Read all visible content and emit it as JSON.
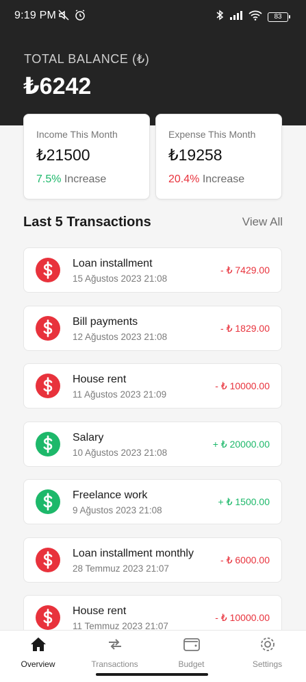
{
  "status_bar": {
    "time": "9:19 PM",
    "battery": "83",
    "icons": [
      "mute-icon",
      "alarm-icon",
      "bluetooth-icon",
      "signal-icon",
      "wifi-icon",
      "battery-icon"
    ]
  },
  "balance": {
    "label": "TOTAL BALANCE (₺)",
    "value": "₺6242"
  },
  "income_card": {
    "title": "Income This Month",
    "amount": "₺21500",
    "percent": "7.5%",
    "trend": "Increase"
  },
  "expense_card": {
    "title": "Expense This Month",
    "amount": "₺19258",
    "percent": "20.4%",
    "trend": "Increase"
  },
  "transactions_section": {
    "title": "Last 5 Transactions",
    "view_all": "View All"
  },
  "transactions": [
    {
      "name": "Loan installment",
      "date": "15 Ağustos 2023 21:08",
      "amount": "- ₺ 7429.00",
      "type": "expense"
    },
    {
      "name": "Bill payments",
      "date": "12 Ağustos 2023 21:08",
      "amount": "- ₺ 1829.00",
      "type": "expense"
    },
    {
      "name": "House rent",
      "date": "11 Ağustos 2023 21:09",
      "amount": "- ₺ 10000.00",
      "type": "expense"
    },
    {
      "name": "Salary",
      "date": "10 Ağustos 2023 21:08",
      "amount": "+ ₺ 20000.00",
      "type": "income"
    },
    {
      "name": "Freelance work",
      "date": "9 Ağustos 2023 21:08",
      "amount": "+ ₺ 1500.00",
      "type": "income"
    },
    {
      "name": "Loan installment monthly",
      "date": "28 Temmuz 2023 21:07",
      "amount": "- ₺ 6000.00",
      "type": "expense"
    },
    {
      "name": "House rent",
      "date": "11 Temmuz 2023 21:07",
      "amount": "- ₺ 10000.00",
      "type": "expense"
    }
  ],
  "colors": {
    "header": "#242424",
    "income": "#1db86a",
    "expense": "#e8323c"
  },
  "bottom_nav": [
    {
      "label": "Overview",
      "icon": "home-icon",
      "active": true
    },
    {
      "label": "Transactions",
      "icon": "transfer-icon",
      "active": false
    },
    {
      "label": "Budget",
      "icon": "wallet-icon",
      "active": false
    },
    {
      "label": "Settings",
      "icon": "gear-icon",
      "active": false
    }
  ]
}
